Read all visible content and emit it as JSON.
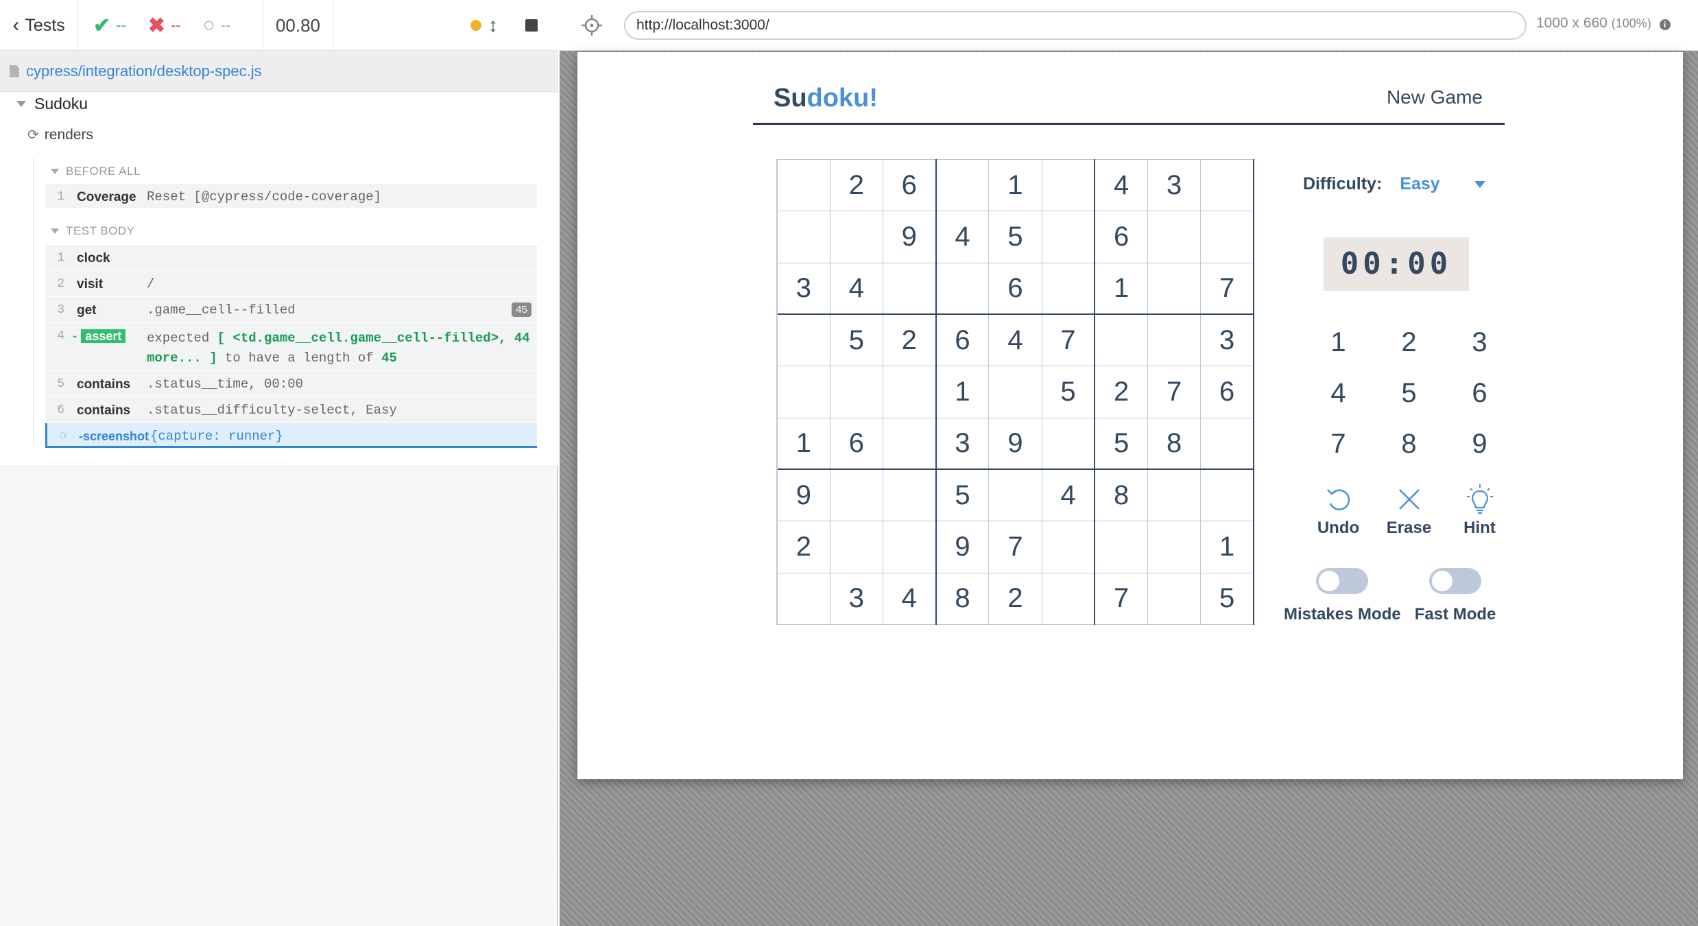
{
  "runner": {
    "tests_label": "Tests",
    "passed": "--",
    "failed": "--",
    "pending": "--",
    "duration": "00.80",
    "spec_path": "cypress/integration/desktop-spec.js",
    "suite_title": "Sudoku",
    "test_title": "renders",
    "hook_before": "BEFORE ALL",
    "hook_body": "TEST BODY",
    "commands": [
      {
        "num": "1",
        "name": "Coverage",
        "message": "Reset [@cypress/code-coverage]"
      },
      {
        "num": "1",
        "name": "clock",
        "message": ""
      },
      {
        "num": "2",
        "name": "visit",
        "message": "/"
      },
      {
        "num": "3",
        "name": "get",
        "message": ".game__cell--filled",
        "badge": "45"
      },
      {
        "num": "4",
        "name": "assert",
        "message_pre": "expected",
        "message_subject": "[ <td.game__cell.game__cell--filled>, 44 more... ]",
        "message_mid": "to have a length of",
        "message_value": "45"
      },
      {
        "num": "5",
        "name": "contains",
        "message": ".status__time, 00:00"
      },
      {
        "num": "6",
        "name": "contains",
        "message": ".status__difficulty-select, Easy"
      },
      {
        "num": "",
        "name": "-screenshot",
        "message": "{capture: runner}"
      }
    ]
  },
  "browser": {
    "url": "http://localhost:3000/",
    "viewport": "1000 x 660",
    "zoom": "(100%)"
  },
  "app": {
    "logo_part1": "Su",
    "logo_part2": "doku!",
    "new_game": "New Game",
    "difficulty_label": "Difficulty:",
    "difficulty_value": "Easy",
    "timer": "00:00",
    "numpad": [
      "1",
      "2",
      "3",
      "4",
      "5",
      "6",
      "7",
      "8",
      "9"
    ],
    "undo": "Undo",
    "erase": "Erase",
    "hint": "Hint",
    "mistakes_mode": "Mistakes Mode",
    "fast_mode": "Fast Mode",
    "grid": [
      [
        "",
        "2",
        "6",
        "",
        "1",
        "",
        "4",
        "3",
        ""
      ],
      [
        "",
        "",
        "9",
        "4",
        "5",
        "",
        "6",
        "",
        ""
      ],
      [
        "3",
        "4",
        "",
        "",
        "6",
        "",
        "1",
        "",
        "7"
      ],
      [
        "",
        "5",
        "2",
        "6",
        "4",
        "7",
        "",
        "",
        "3"
      ],
      [
        "",
        "",
        "",
        "1",
        "",
        "5",
        "2",
        "7",
        "6"
      ],
      [
        "1",
        "6",
        "",
        "3",
        "9",
        "",
        "5",
        "8",
        ""
      ],
      [
        "9",
        "",
        "",
        "5",
        "",
        "4",
        "8",
        "",
        ""
      ],
      [
        "2",
        "",
        "",
        "9",
        "7",
        "",
        "",
        "",
        "1"
      ],
      [
        "",
        "3",
        "4",
        "8",
        "2",
        "",
        "7",
        "",
        "5"
      ]
    ]
  },
  "colors": {
    "pass": "#2fbf71",
    "fail": "#e94f5f",
    "link": "#3386d6",
    "app_text": "#344861",
    "app_accent": "#4a90d9"
  }
}
